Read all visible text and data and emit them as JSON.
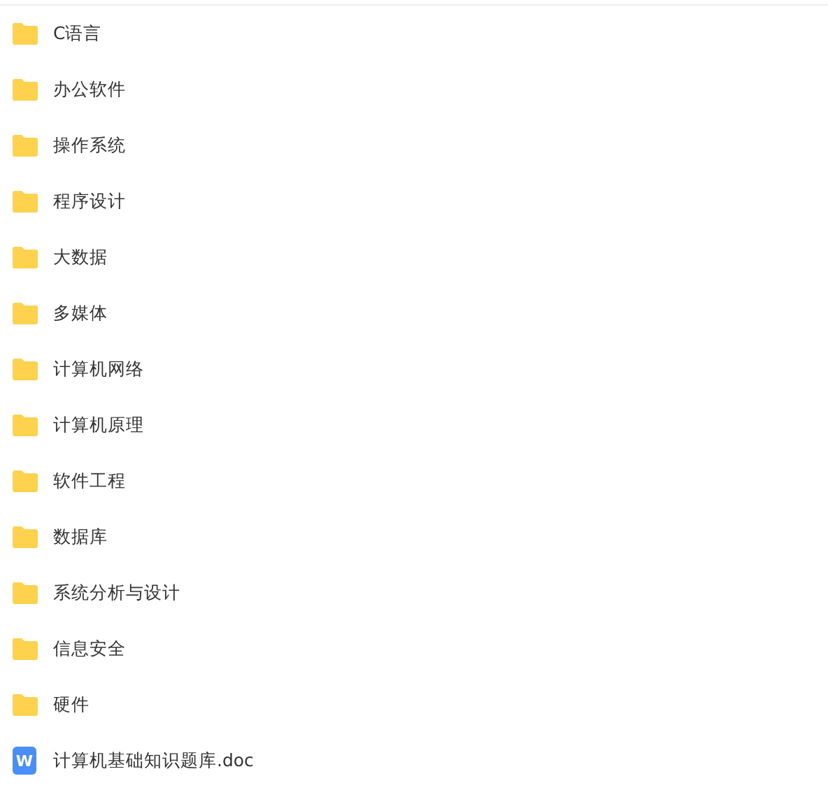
{
  "files": [
    {
      "kind": "folder",
      "name": "C语言"
    },
    {
      "kind": "folder",
      "name": "办公软件"
    },
    {
      "kind": "folder",
      "name": "操作系统"
    },
    {
      "kind": "folder",
      "name": "程序设计"
    },
    {
      "kind": "folder",
      "name": "大数据"
    },
    {
      "kind": "folder",
      "name": "多媒体"
    },
    {
      "kind": "folder",
      "name": "计算机网络"
    },
    {
      "kind": "folder",
      "name": "计算机原理"
    },
    {
      "kind": "folder",
      "name": "软件工程"
    },
    {
      "kind": "folder",
      "name": "数据库"
    },
    {
      "kind": "folder",
      "name": "系统分析与设计"
    },
    {
      "kind": "folder",
      "name": "信息安全"
    },
    {
      "kind": "folder",
      "name": "硬件"
    },
    {
      "kind": "doc",
      "name": "计算机基础知识题库.doc",
      "icon_letter": "W"
    }
  ]
}
